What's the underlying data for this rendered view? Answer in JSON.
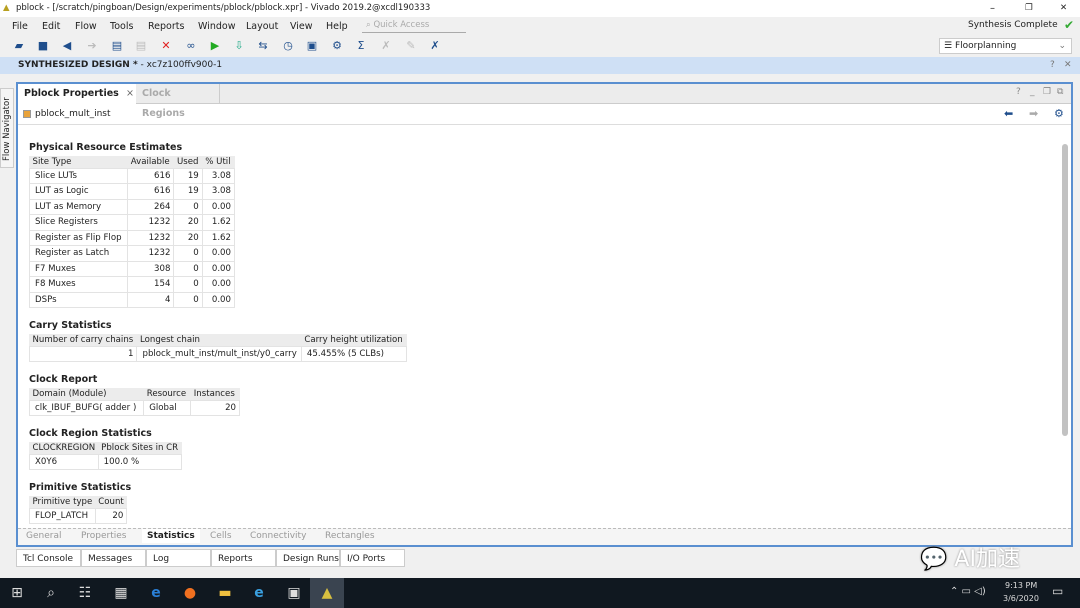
{
  "window": {
    "title": "pblock - [/scratch/pingboan/Design/experiments/pblock/pblock.xpr] - Vivado 2019.2@xcdl190333",
    "minimize": "–",
    "restore": "❐",
    "close": "✕"
  },
  "menu": [
    "File",
    "Edit",
    "Flow",
    "Tools",
    "Reports",
    "Window",
    "Layout",
    "View",
    "Help"
  ],
  "quick_access_placeholder": "Quick Access",
  "status": "Synthesis Complete",
  "layout_select": "Floorplanning",
  "toolbar_icons": [
    "open-icon",
    "save-icon",
    "undo-icon",
    "redo-icon",
    "copy-icon",
    "paste-icon",
    "delete-icon",
    "find-icon",
    "run-icon",
    "step-icon",
    "sync-icon",
    "timer-icon",
    "report-icon",
    "settings-icon",
    "sigma-icon",
    "tool-icon",
    "pencil-icon",
    "cross-tool-icon"
  ],
  "design_header": {
    "title": "SYNTHESIZED DESIGN *",
    "part": "- xc7z100ffv900-1"
  },
  "flow_navigator": "Flow Navigator",
  "panel": {
    "tabs": [
      "Pblock Properties",
      "Clock Regions"
    ],
    "object": "pblock_mult_inst"
  },
  "physical": {
    "title": "Physical Resource Estimates",
    "headers": [
      "Site Type",
      "Available",
      "Used",
      "% Util"
    ],
    "rows": [
      [
        "Slice LUTs",
        "616",
        "19",
        "3.08"
      ],
      [
        "LUT as Logic",
        "616",
        "19",
        "3.08"
      ],
      [
        "LUT as Memory",
        "264",
        "0",
        "0.00"
      ],
      [
        "Slice Registers",
        "1232",
        "20",
        "1.62"
      ],
      [
        "Register as Flip Flop",
        "1232",
        "20",
        "1.62"
      ],
      [
        "Register as Latch",
        "1232",
        "0",
        "0.00"
      ],
      [
        "F7 Muxes",
        "308",
        "0",
        "0.00"
      ],
      [
        "F8 Muxes",
        "154",
        "0",
        "0.00"
      ],
      [
        "DSPs",
        "4",
        "0",
        "0.00"
      ]
    ]
  },
  "carry": {
    "title": "Carry Statistics",
    "headers": [
      "Number of carry chains",
      "Longest chain",
      "Carry height utilization"
    ],
    "rows": [
      [
        "1",
        "pblock_mult_inst/mult_inst/y0_carry",
        "45.455% (5 CLBs)"
      ]
    ]
  },
  "clock": {
    "title": "Clock Report",
    "headers": [
      "Domain (Module)",
      "Resource",
      "Instances"
    ],
    "rows": [
      [
        "clk_IBUF_BUFG( adder )",
        "Global",
        "20"
      ]
    ]
  },
  "region": {
    "title": "Clock Region Statistics",
    "headers": [
      "CLOCKREGION",
      "Pblock Sites in CR"
    ],
    "rows": [
      [
        "X0Y6",
        "100.0 %"
      ]
    ]
  },
  "primitive": {
    "title": "Primitive Statistics",
    "headers": [
      "Primitive type",
      "Count"
    ],
    "rows": [
      [
        "FLOP_LATCH",
        "20"
      ]
    ]
  },
  "bottom_tabs": [
    "General",
    "Properties",
    "Statistics",
    "Cells",
    "Connectivity",
    "Rectangles"
  ],
  "active_bottom_tab": "Statistics",
  "console_tabs": [
    "Tcl Console",
    "Messages",
    "Log",
    "Reports",
    "Design Runs",
    "I/O Ports"
  ],
  "watermark": "AI加速",
  "clock_time": "9:13 PM",
  "clock_date": "3/6/2020"
}
